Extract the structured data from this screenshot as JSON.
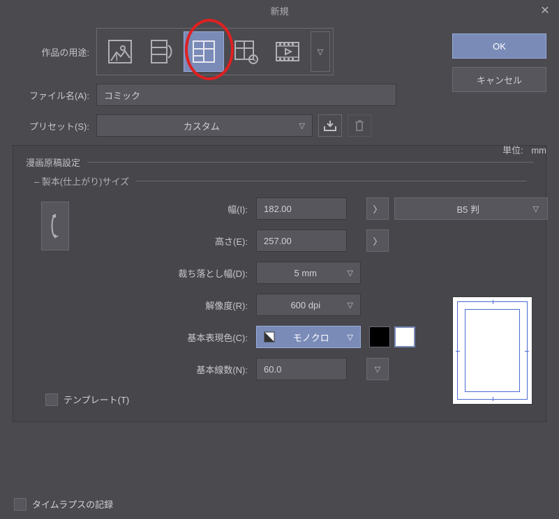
{
  "title": "新規",
  "buttons": {
    "ok": "OK",
    "cancel": "キャンセル"
  },
  "labels": {
    "usage": "作品の用途:",
    "filename": "ファイル名(A):",
    "preset": "プリセット(S):",
    "unit": "単位:",
    "unit_val": "mm"
  },
  "usage_icons": [
    "illustration",
    "webtoon",
    "comic",
    "print-comic",
    "animation"
  ],
  "filename_value": "コミック",
  "preset_value": "カスタム",
  "panel": {
    "title": "漫画原稿設定",
    "subtitle": "– 製本(仕上がり)サイズ",
    "width_label": "幅(I):",
    "width_value": "182.00",
    "height_label": "高さ(E):",
    "height_value": "257.00",
    "bleed_label": "裁ち落とし幅(D):",
    "bleed_value": "5 mm",
    "resolution_label": "解像度(R):",
    "resolution_value": "600 dpi",
    "color_label": "基本表現色(C):",
    "color_value": "モノクロ",
    "screen_label": "基本線数(N):",
    "screen_value": "60.0",
    "size_preset": "B5 判",
    "template_label": "テンプレート(T)"
  },
  "footer": {
    "timelapse": "タイムラプスの記録"
  }
}
